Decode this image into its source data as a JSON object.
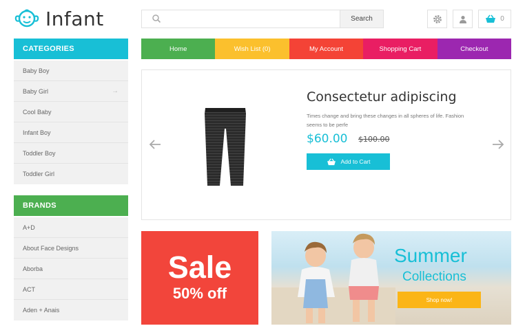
{
  "brand": {
    "name": "Infant",
    "color": "#18bfd6"
  },
  "search": {
    "placeholder": "",
    "button_label": "Search"
  },
  "header": {
    "cart_count": "0",
    "settings_icon": "gear-icon",
    "account_icon": "user-icon",
    "cart_icon": "basket-icon"
  },
  "nav": {
    "tabs": [
      {
        "label": "Home",
        "color": "#4caf50"
      },
      {
        "label": "Wish List (0)",
        "color": "#fbc02d"
      },
      {
        "label": "My Account",
        "color": "#f44336"
      },
      {
        "label": "Shopping Cart",
        "color": "#e91e63"
      },
      {
        "label": "Checkout",
        "color": "#9c27b0"
      }
    ]
  },
  "categories": {
    "title": "CATEGORIES",
    "color": "#18bfd6",
    "items": [
      "Baby Boy",
      "Baby Girl",
      "Cool Baby",
      "Infant Boy",
      "Toddler Boy",
      "Toddler Girl"
    ]
  },
  "brands": {
    "title": "BRANDS",
    "color": "#4caf50",
    "items": [
      "A+D",
      "About Face Designs",
      "Aborba",
      "ACT",
      "Aden + Anais"
    ]
  },
  "slider": {
    "title": "Consectetur adipiscing",
    "description": "Times change and bring these changes in all spheres of life. Fashion seems to be perfe",
    "price": "$60.00",
    "old_price": "$100.00",
    "add_to_cart": "Add to Cart"
  },
  "banners": {
    "sale": {
      "line1": "Sale",
      "line2": "50% off",
      "color": "#f2453b"
    },
    "summer": {
      "line1": "Summer",
      "line2": "Collections",
      "button": "Shop now!",
      "button_color": "#fbb517"
    }
  }
}
